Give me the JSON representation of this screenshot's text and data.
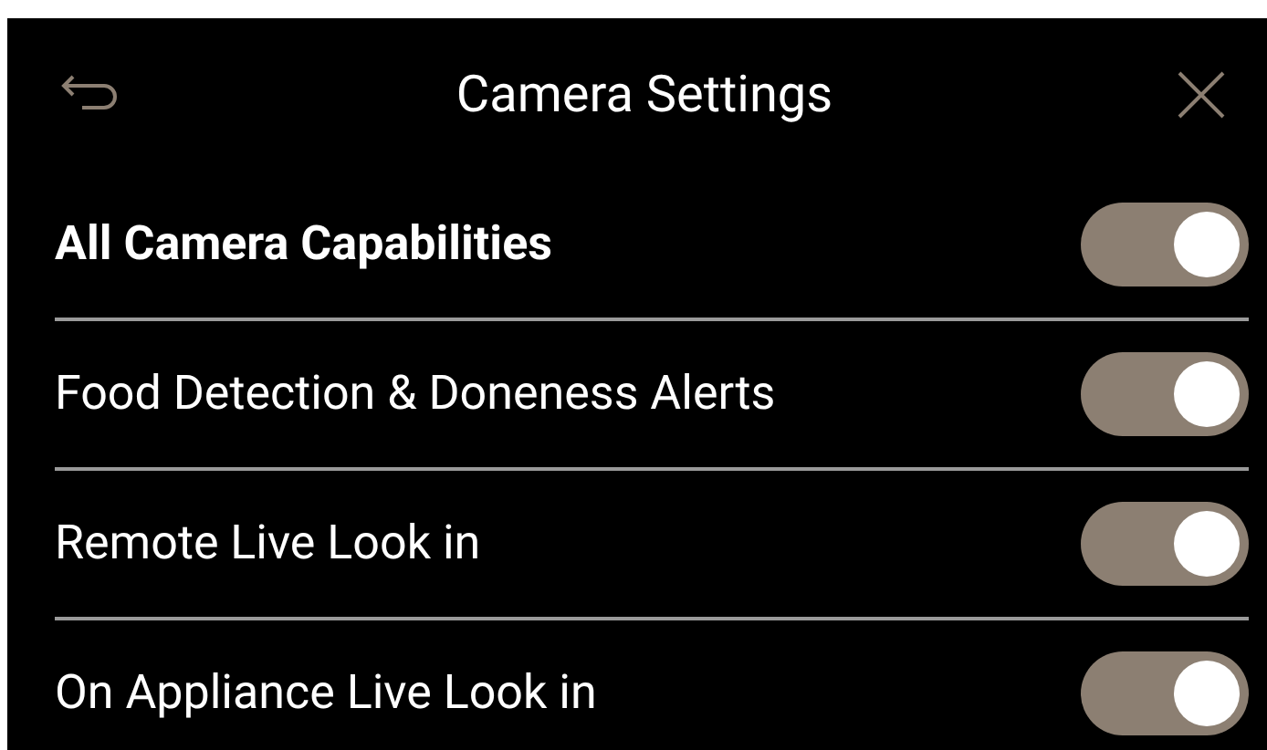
{
  "header": {
    "title": "Camera Settings"
  },
  "settings": [
    {
      "label": "All Camera Capabilities",
      "bold": true,
      "on": true
    },
    {
      "label": "Food Detection & Doneness Alerts",
      "bold": false,
      "on": true
    },
    {
      "label": "Remote Live Look in",
      "bold": false,
      "on": true
    },
    {
      "label": "On Appliance Live Look in",
      "bold": false,
      "on": true
    }
  ]
}
